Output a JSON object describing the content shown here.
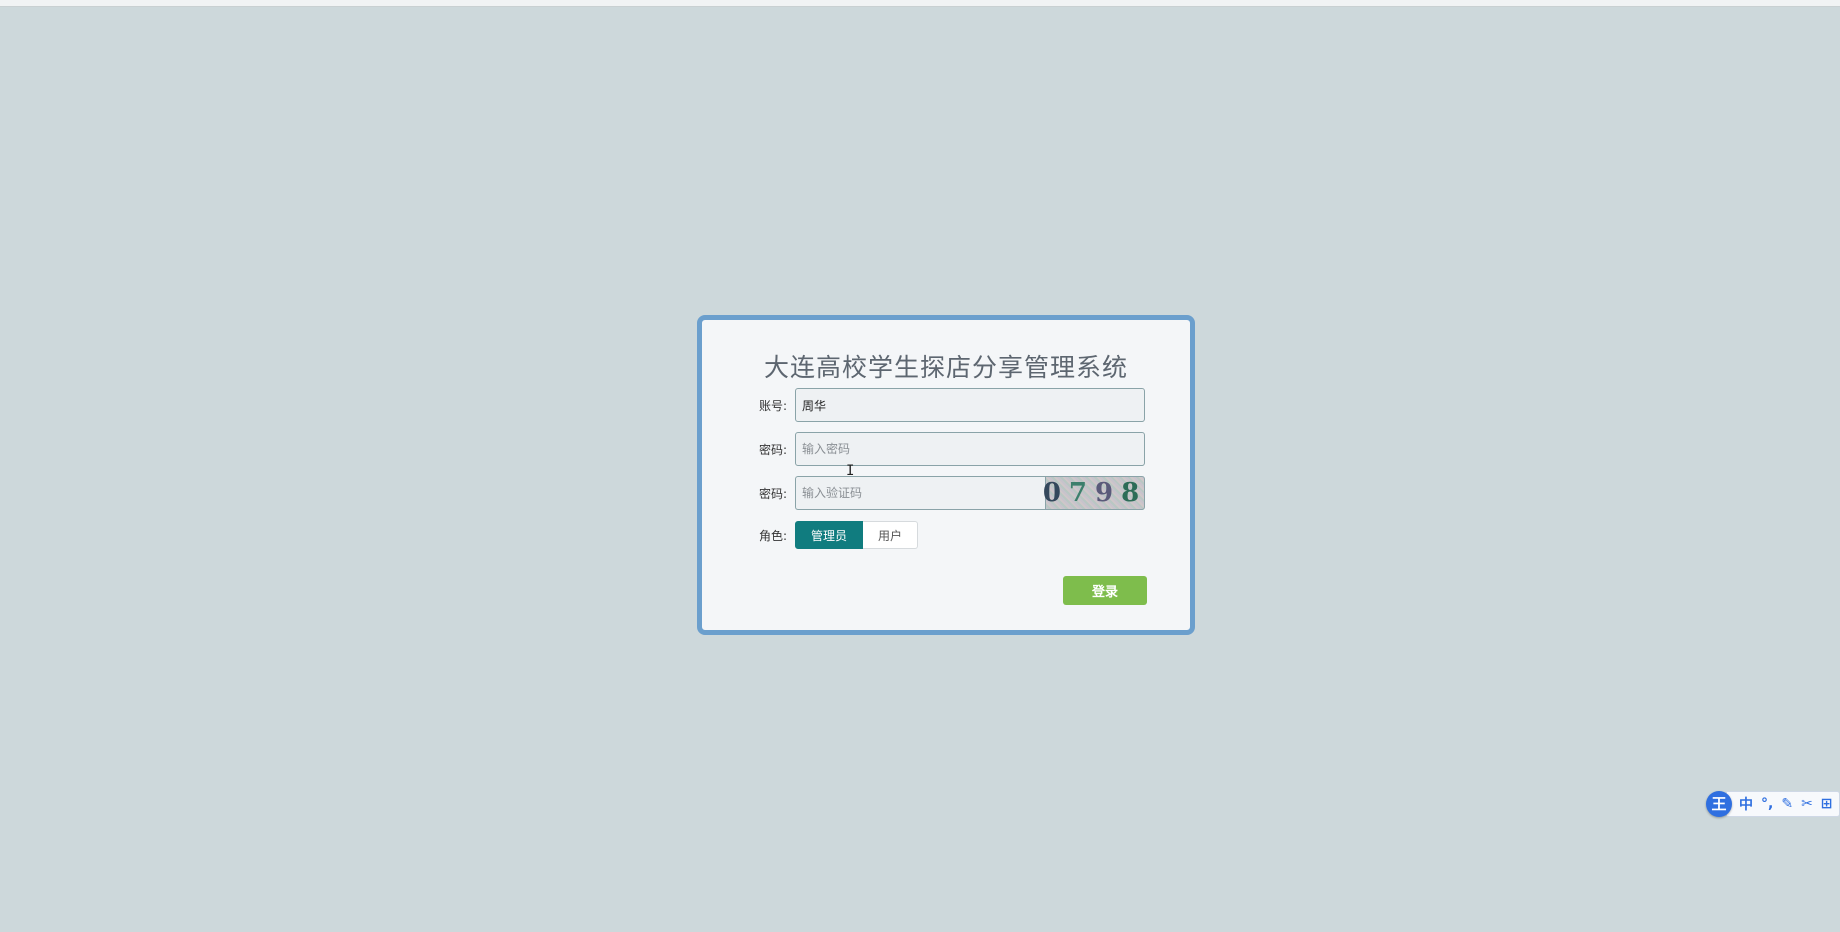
{
  "login": {
    "title": "大连高校学生探店分享管理系统",
    "account_label": "账号:",
    "account_value": "周华",
    "password_label": "密码:",
    "password_placeholder": "输入密码",
    "captcha_label": "密码:",
    "captcha_placeholder": "输入验证码",
    "captcha_code": [
      "0",
      "7",
      "9",
      "8"
    ],
    "role_label": "角色:",
    "roles": [
      "管理员",
      "用户"
    ],
    "selected_role": "管理员",
    "login_button": "登录"
  },
  "ime_toolbar": {
    "logo": "王",
    "items": [
      "中",
      "°,",
      "✎",
      "✂",
      "⊞"
    ]
  },
  "colors": {
    "background": "#cdd8db",
    "card_border": "#6b9fcd",
    "role_active": "#107c7f",
    "login_button": "#7ebd4c"
  }
}
